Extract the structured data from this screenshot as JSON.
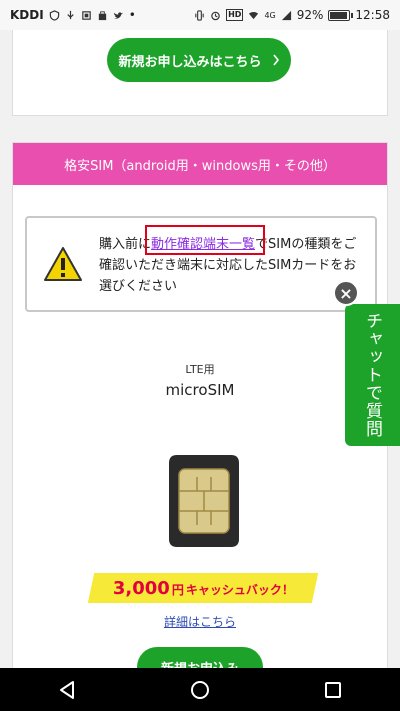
{
  "status_bar": {
    "carrier": "KDDI",
    "battery": "92%",
    "time": "12:58",
    "network": "4G",
    "hd_badge": "HD"
  },
  "top_section": {
    "apply_button_label": "新規お申し込みはこちら"
  },
  "sim_section": {
    "header": "格安SIM（android用・windows用・その他）",
    "warning": {
      "text_before": "購入前に",
      "link_text": "動作確認端末一覧",
      "text_after": "でSIMの種類をご確認いただき端末に対応したSIMカードをお選びください"
    },
    "product": {
      "lte_label": "LTE用",
      "name": "microSIM",
      "cashback_amount": "3,000",
      "cashback_unit": "円",
      "cashback_text": "キャッシュバック！",
      "details_link": "詳細はこちら",
      "apply_button_label": "新規お申込み"
    }
  },
  "chat": {
    "label": "チャットで質問",
    "close_symbol": "×"
  },
  "colors": {
    "green": "#1ea32a",
    "pink": "#e94fae",
    "highlight_red": "#e0001a",
    "cashback_yellow": "#f6e938"
  },
  "icons": [
    "warning-icon",
    "chevron-right-icon",
    "close-icon",
    "back-icon",
    "home-icon",
    "recents-icon"
  ]
}
